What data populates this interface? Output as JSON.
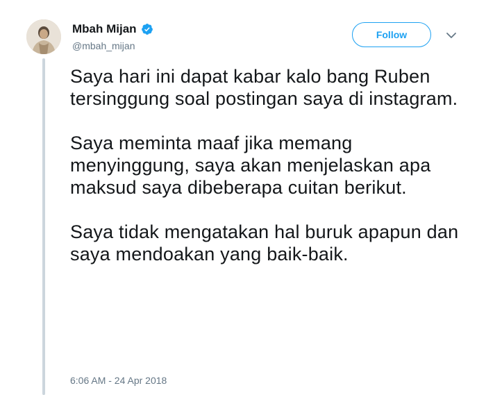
{
  "author": {
    "display_name": "Mbah Mijan",
    "handle": "@mbah_mijan",
    "verified": true,
    "avatar_icon": "avatar-photo"
  },
  "actions": {
    "follow_label": "Follow",
    "more_icon": "chevron-down-icon"
  },
  "tweet": {
    "paragraphs": [
      "Saya hari ini dapat kabar kalo bang Ruben tersinggung soal postingan saya di instagram.",
      "Saya meminta maaf jika memang menyinggung, saya akan menjelaskan apa maksud saya dibeberapa cuitan berikut.",
      "Saya tidak mengatakan hal buruk apapun dan saya mendoakan yang baik-baik."
    ],
    "timestamp": "6:06 AM - 24 Apr 2018"
  },
  "colors": {
    "accent": "#1da1f2",
    "text": "#14171a",
    "muted": "#657786",
    "thread_line": "#ccd6dd"
  }
}
